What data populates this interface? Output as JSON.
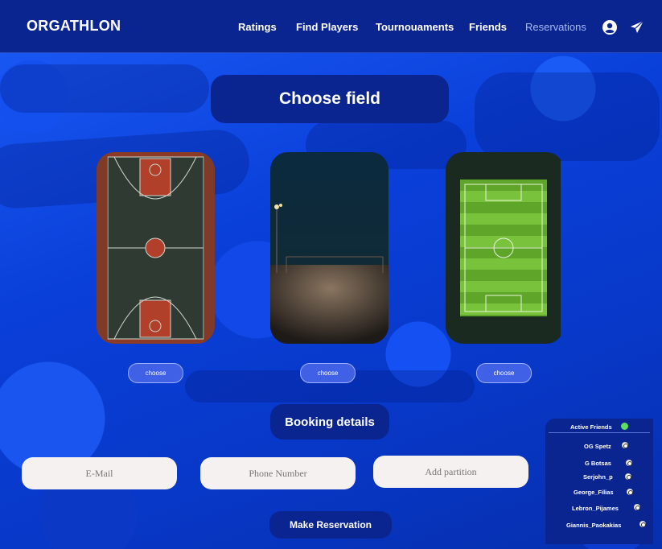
{
  "navbar": {
    "brand": "ORGATHLON",
    "links": [
      "Ratings",
      "Find Players",
      "Tournouaments",
      "Friends",
      "Reservations"
    ],
    "active_link": "Reservations",
    "icons": [
      "user-circle-icon",
      "paper-plane-icon"
    ]
  },
  "choose_field": {
    "title": "Choose field",
    "fields": [
      {
        "image": "basketball-court",
        "button": "choose"
      },
      {
        "image": "night-beach-field",
        "button": "choose"
      },
      {
        "image": "soccer-field",
        "button": "choose"
      }
    ]
  },
  "booking": {
    "title": "Booking details",
    "inputs": {
      "email_placeholder": "E-Mail",
      "phone_placeholder": "Phone Number",
      "partition_placeholder": "Add partition"
    },
    "submit_label": "Make Reservation"
  },
  "active_friends": {
    "title": "Active Friends",
    "status_color": "#5ee05e",
    "friends": [
      "OG Spetz",
      "G Botsas",
      "Serjohn_p",
      "George_Filias",
      "Lebron_Pijames",
      "Giannis_Paokakias"
    ]
  },
  "colors": {
    "navy": "#0a2490",
    "background_blue": "#0a3fd6",
    "button_blue": "#4060e6"
  }
}
